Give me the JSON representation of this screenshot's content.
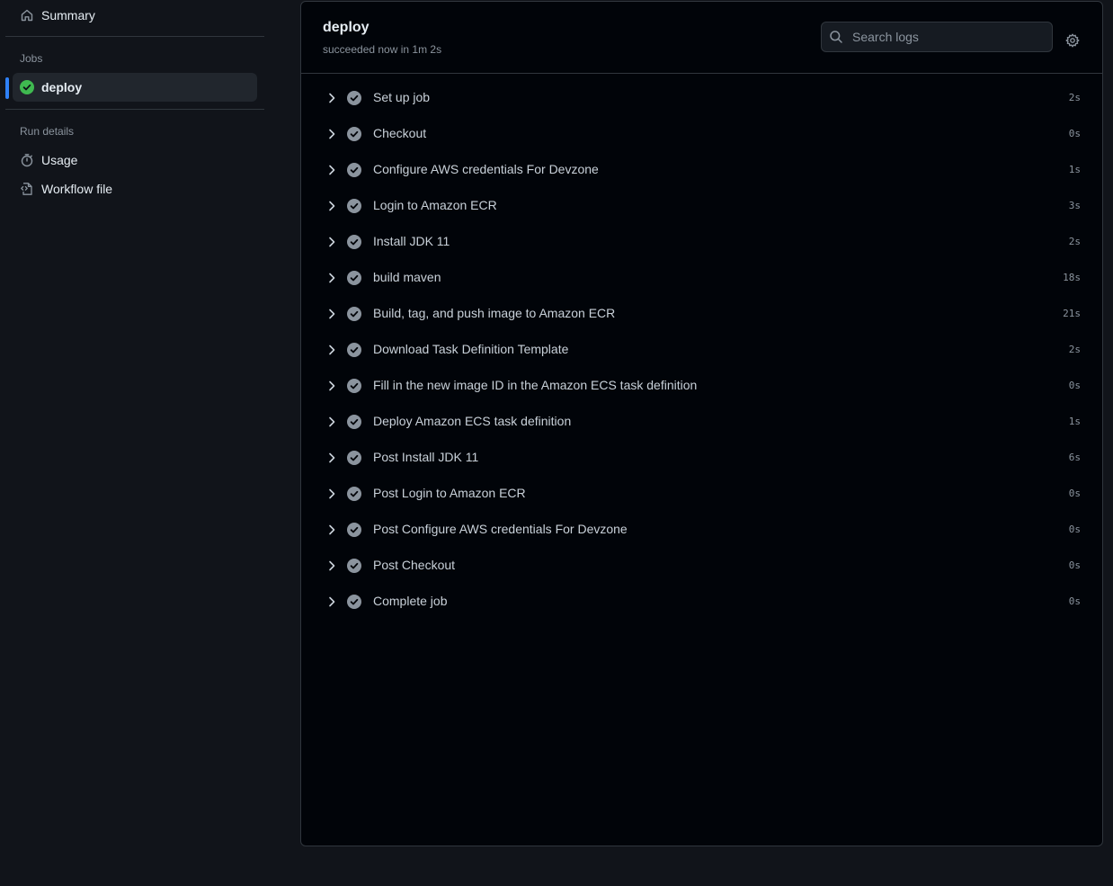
{
  "sidebar": {
    "summary_label": "Summary",
    "jobs_heading": "Jobs",
    "job_label": "deploy",
    "run_details_heading": "Run details",
    "usage_label": "Usage",
    "workflow_file_label": "Workflow file"
  },
  "job": {
    "title": "deploy",
    "status": "succeeded now in 1m 2s"
  },
  "search": {
    "placeholder": "Search logs"
  },
  "steps": [
    {
      "name": "Set up job",
      "duration": "2s"
    },
    {
      "name": "Checkout",
      "duration": "0s"
    },
    {
      "name": "Configure AWS credentials For Devzone",
      "duration": "1s"
    },
    {
      "name": "Login to Amazon ECR",
      "duration": "3s"
    },
    {
      "name": "Install JDK 11",
      "duration": "2s"
    },
    {
      "name": "build maven",
      "duration": "18s"
    },
    {
      "name": "Build, tag, and push image to Amazon ECR",
      "duration": "21s"
    },
    {
      "name": "Download Task Definition Template",
      "duration": "2s"
    },
    {
      "name": "Fill in the new image ID in the Amazon ECS task definition",
      "duration": "0s"
    },
    {
      "name": "Deploy Amazon ECS task definition",
      "duration": "1s"
    },
    {
      "name": "Post Install JDK 11",
      "duration": "6s"
    },
    {
      "name": "Post Login to Amazon ECR",
      "duration": "0s"
    },
    {
      "name": "Post Configure AWS credentials For Devzone",
      "duration": "0s"
    },
    {
      "name": "Post Checkout",
      "duration": "0s"
    },
    {
      "name": "Complete job",
      "duration": "0s"
    }
  ],
  "colors": {
    "success": "#3fb950",
    "step_check": "#8b949e",
    "accent": "#2f81f7"
  }
}
